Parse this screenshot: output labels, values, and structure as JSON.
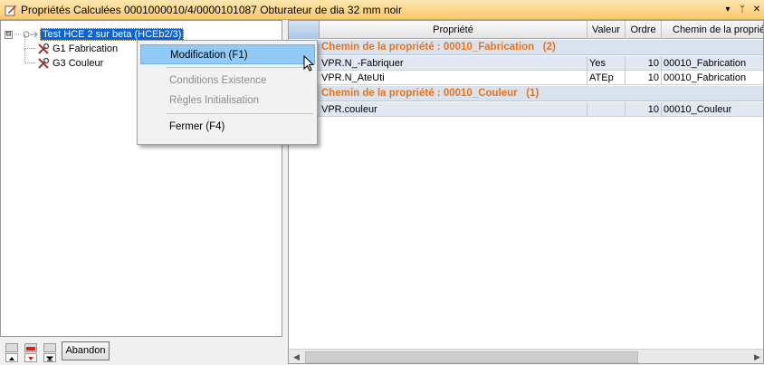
{
  "window": {
    "title": "Propriétés Calculées 0001000010/4/0000101087 Obturateur de dia 32 mm noir",
    "controls": {
      "dropdown": "▾",
      "pin": "ᛘ",
      "close": "✕"
    }
  },
  "tree": {
    "root_label": "Test HCE 2 sur beta (HCEb2/3)",
    "expander": "⊟",
    "children": [
      {
        "label": "G1 Fabrication"
      },
      {
        "label": "G3 Couleur"
      }
    ]
  },
  "context_menu": {
    "items": [
      {
        "label": "Modification (F1)",
        "state": "hover"
      },
      {
        "label": "Conditions Existence",
        "state": "disabled"
      },
      {
        "label": "Règles Initialisation",
        "state": "disabled"
      },
      {
        "label": "Fermer (F4)",
        "state": "enabled"
      }
    ]
  },
  "grid": {
    "columns": [
      "Propriété",
      "Valeur",
      "Ordre",
      "Chemin de la propriété"
    ],
    "groups": [
      {
        "header": "Chemin de la propriété : 00010_Fabrication   (2)",
        "rows": [
          {
            "propriete": "VPR.N_-Fabriquer",
            "valeur": "Yes",
            "ordre": "10",
            "chemin": "00010_Fabrication"
          },
          {
            "propriete": "VPR.N_AteUti",
            "valeur": "ATEp",
            "ordre": "10",
            "chemin": "00010_Fabrication"
          }
        ]
      },
      {
        "header": "Chemin de la propriété : 00010_Couleur   (1)",
        "rows": [
          {
            "propriete": "VPR.couleur",
            "valeur": "",
            "ordre": "10",
            "chemin": "00010_Couleur"
          }
        ]
      }
    ]
  },
  "footer": {
    "abandon_label": "Abandon"
  },
  "colors": {
    "title_bar": "#f8c96a",
    "group_text": "#e8741a",
    "selection": "#0a64d8",
    "menu_hover": "#91c9f7",
    "row_alt": "#dfe8f3"
  }
}
